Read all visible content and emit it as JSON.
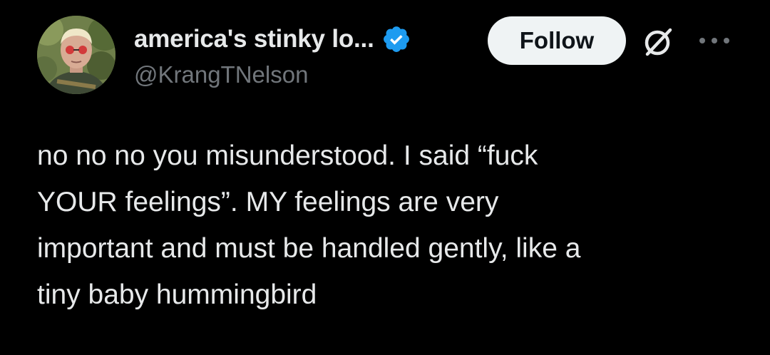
{
  "author": {
    "display_name": "america's stinky lo...",
    "handle": "@KrangTNelson",
    "verified": true,
    "avatar_icon": "profile-photo"
  },
  "actions": {
    "follow_label": "Follow",
    "grok_icon": "grok-icon",
    "more_icon": "more-icon"
  },
  "tweet": {
    "lines": [
      "no no no you misunderstood. I said “fuck",
      "YOUR feelings”. MY feelings are very",
      "important and must be handled gently, like a",
      "tiny baby hummingbird"
    ]
  },
  "colors": {
    "background": "#000000",
    "text_primary": "#e7e9ea",
    "text_secondary": "#71767b",
    "verified_blue": "#1d9bf0",
    "follow_bg": "#eff3f4",
    "follow_text": "#0f1419"
  }
}
